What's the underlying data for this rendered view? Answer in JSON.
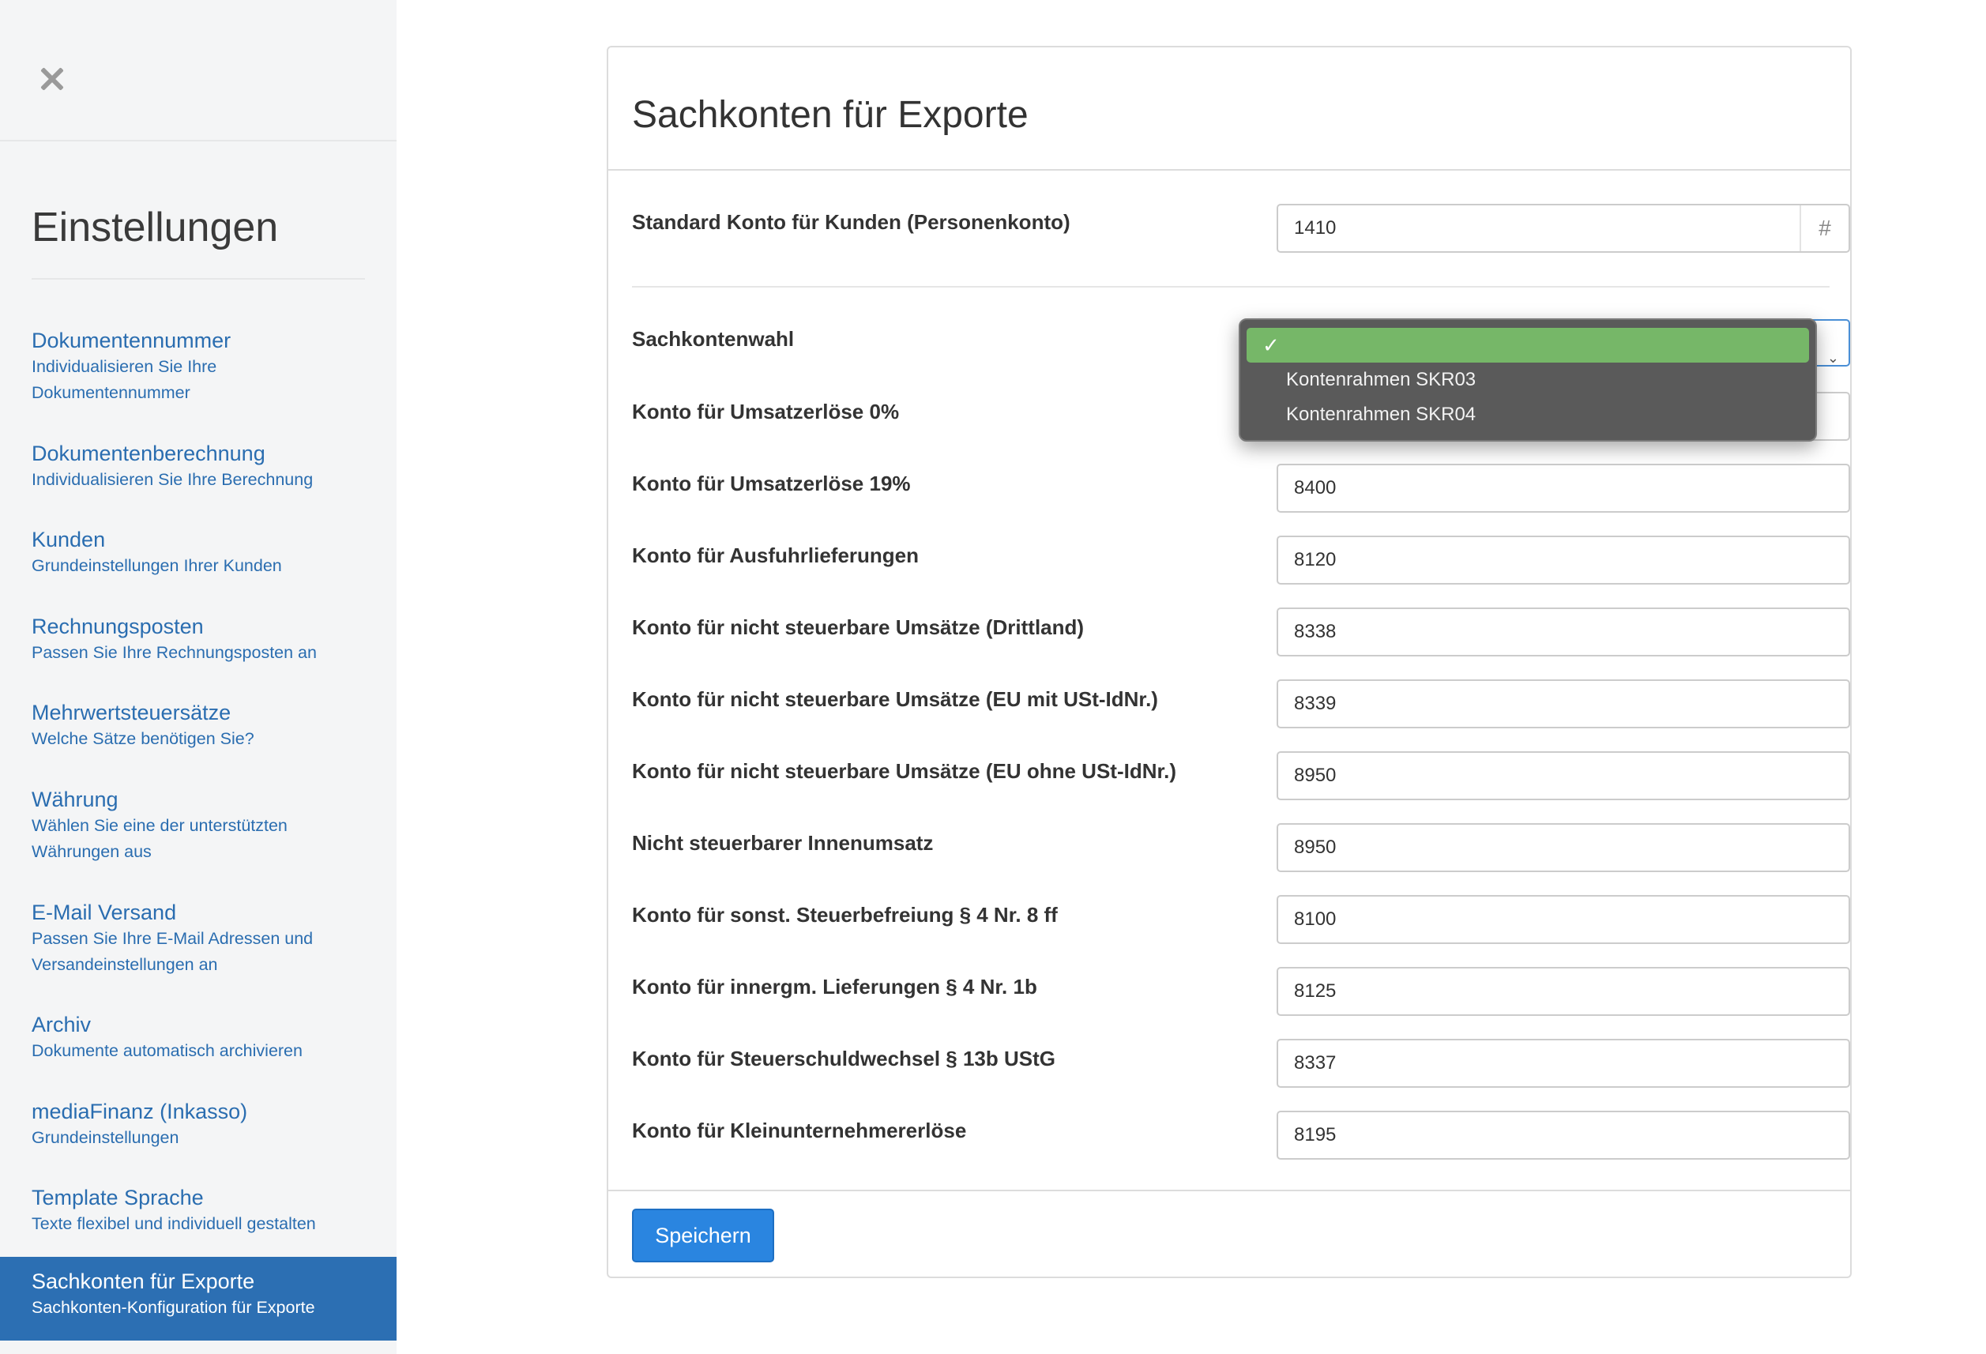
{
  "sidebar": {
    "title": "Einstellungen",
    "items": [
      {
        "title": "Dokumentennummer",
        "sub": "Individualisieren Sie Ihre Dokumentennummer"
      },
      {
        "title": "Dokumentenberechnung",
        "sub": "Individualisieren Sie Ihre Berechnung"
      },
      {
        "title": "Kunden",
        "sub": "Grundeinstellungen Ihrer Kunden"
      },
      {
        "title": "Rechnungsposten",
        "sub": "Passen Sie Ihre Rechnungsposten an"
      },
      {
        "title": "Mehrwertsteuersätze",
        "sub": "Welche Sätze benötigen Sie?"
      },
      {
        "title": "Währung",
        "sub": "Wählen Sie eine der unterstützten Währungen aus"
      },
      {
        "title": "E-Mail Versand",
        "sub": "Passen Sie Ihre E-Mail Adressen und Versandeinstellungen an"
      },
      {
        "title": "Archiv",
        "sub": "Dokumente automatisch archivieren"
      },
      {
        "title": "mediaFinanz (Inkasso)",
        "sub": "Grundeinstellungen"
      },
      {
        "title": "Template Sprache",
        "sub": "Texte flexibel und individuell gestalten"
      },
      {
        "title": "Sachkonten für Exporte",
        "sub": "Sachkonten-Konfiguration für Exporte"
      }
    ]
  },
  "panel": {
    "title": "Sachkonten für Exporte",
    "customer_account": {
      "label": "Standard Konto für Kunden (Personenkonto)",
      "value": "1410",
      "addon": "#"
    },
    "chart_select": {
      "label": "Sachkontenwahl",
      "value": ""
    },
    "dropdown": {
      "check": "✓",
      "options": [
        "",
        "Kontenrahmen SKR03",
        "Kontenrahmen SKR04"
      ]
    },
    "fields": [
      {
        "label": "Konto für Umsatzerlöse 0%",
        "value": ""
      },
      {
        "label": "Konto für Umsatzerlöse 19%",
        "value": "8400"
      },
      {
        "label": "Konto für Ausfuhrlieferungen",
        "value": "8120"
      },
      {
        "label": "Konto für nicht steuerbare Umsätze (Drittland)",
        "value": "8338"
      },
      {
        "label": "Konto für nicht steuerbare Umsätze (EU mit USt-IdNr.)",
        "value": "8339"
      },
      {
        "label": "Konto für nicht steuerbare Umsätze (EU ohne USt-IdNr.)",
        "value": "8950"
      },
      {
        "label": "Nicht steuerbarer Innenumsatz",
        "value": "8950"
      },
      {
        "label": "Konto für sonst. Steuerbefreiung § 4 Nr. 8 ff",
        "value": "8100"
      },
      {
        "label": "Konto für innergm. Lieferungen § 4 Nr. 1b",
        "value": "8125"
      },
      {
        "label": "Konto für Steuerschuldwechsel § 13b UStG",
        "value": "8337"
      },
      {
        "label": "Konto für Kleinunternehmererlöse",
        "value": "8195"
      }
    ],
    "save_label": "Speichern"
  }
}
